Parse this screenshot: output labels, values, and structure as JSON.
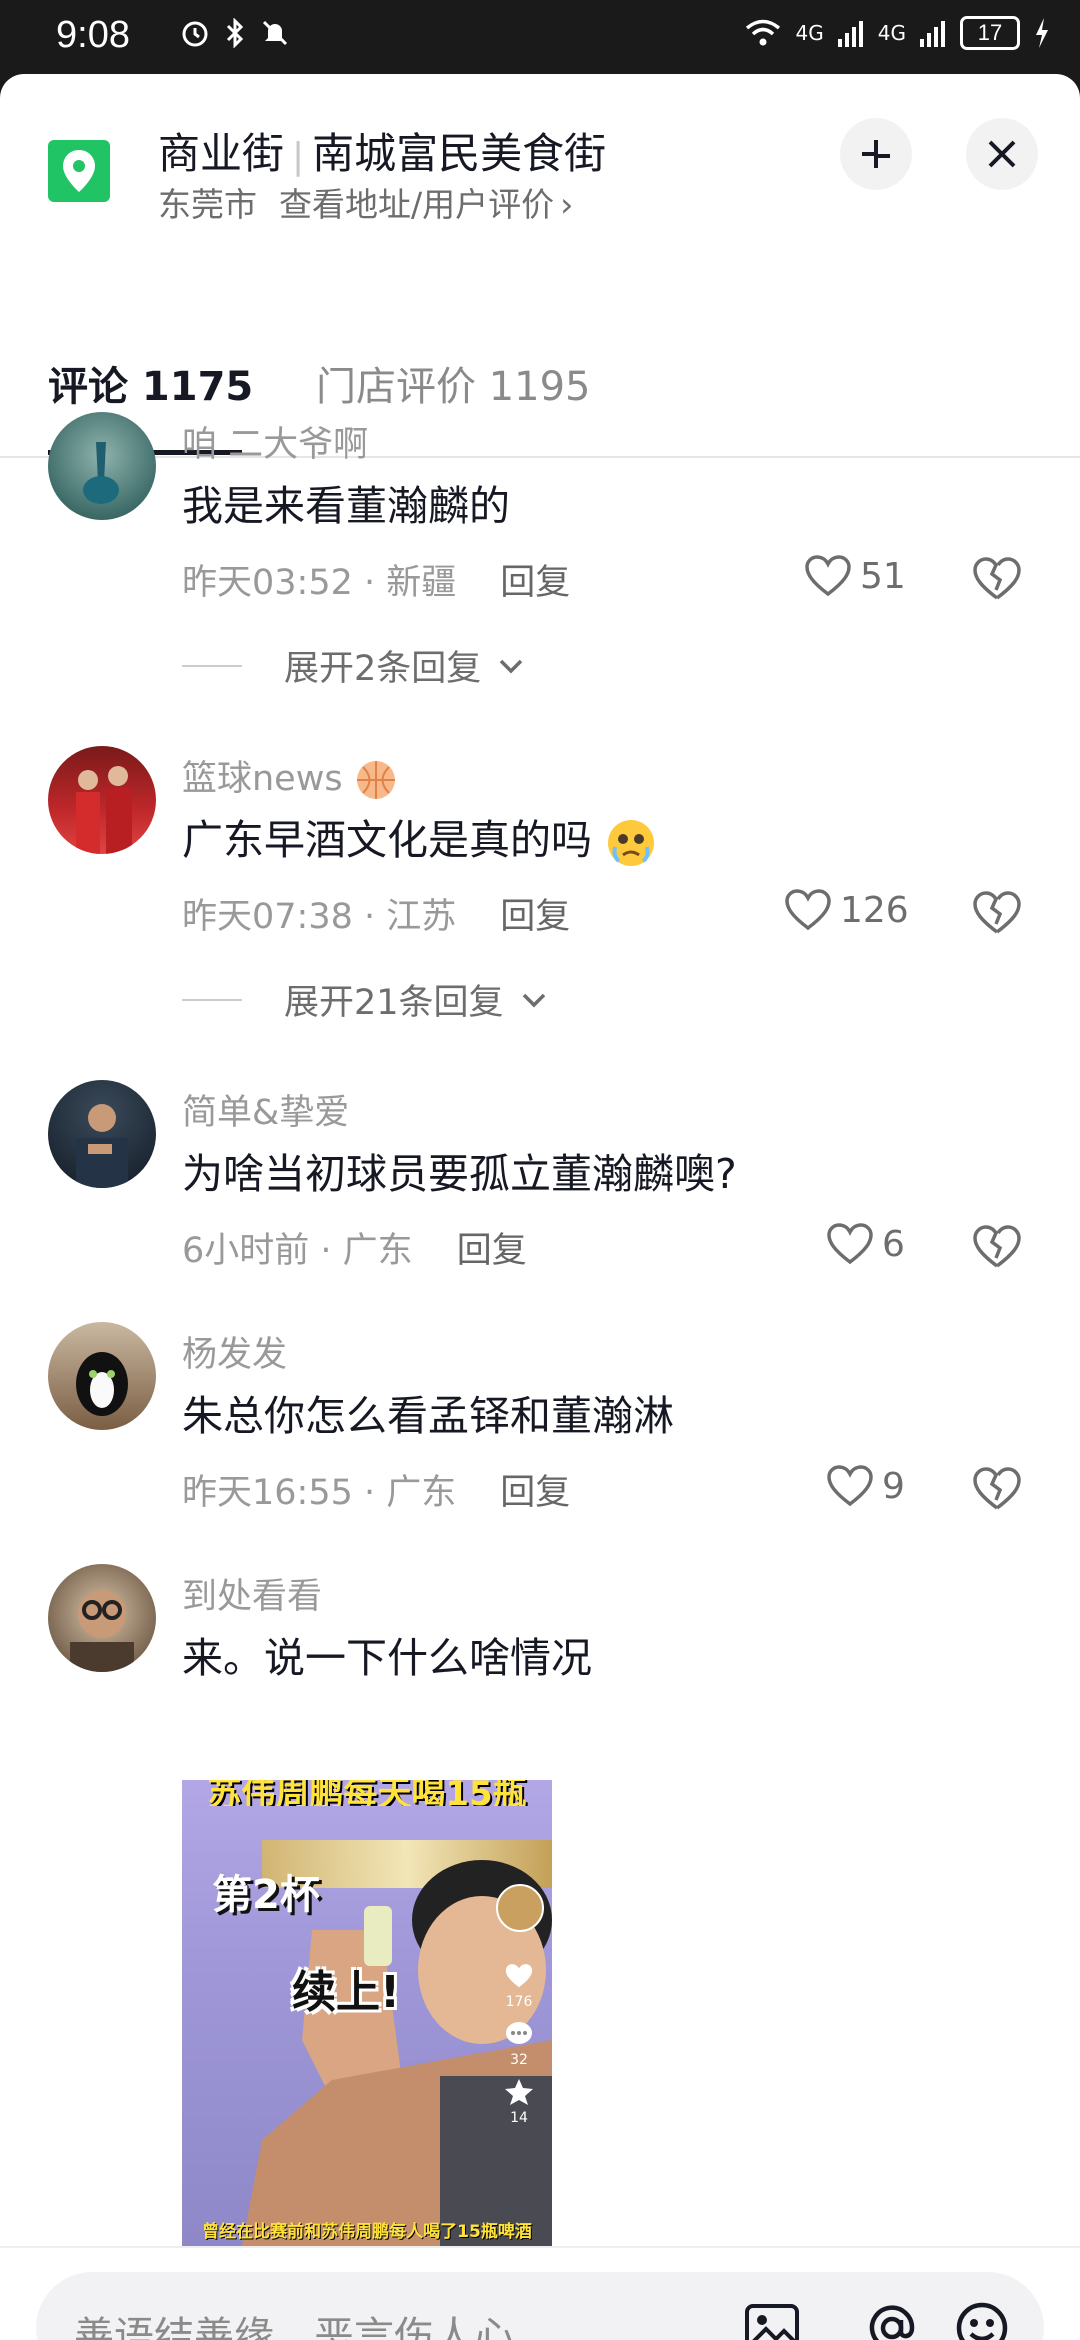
{
  "status_bar": {
    "time": "9:08",
    "left_icons": [
      "alarm-icon",
      "bluetooth-icon",
      "mute-icon"
    ],
    "signal_label_1": "4G",
    "signal_label_2": "4G",
    "battery": "17"
  },
  "header": {
    "title_left": "商业街",
    "title_right": "南城富民美食街",
    "city": "东莞市",
    "sub_link": "查看地址/用户评价",
    "chevron": "›"
  },
  "tabs": [
    {
      "label": "评论 1175",
      "active": true
    },
    {
      "label": "门店评价 1195",
      "active": false
    }
  ],
  "comments": [
    {
      "username": "咱  二大爷啊",
      "text": "我是来看董瀚麟的",
      "time": "昨天03:52",
      "location": "新疆",
      "reply_label": "回复",
      "likes": "51",
      "expand": "展开2条回复"
    },
    {
      "username": "篮球news",
      "text": "广东早酒文化是真的吗",
      "time": "昨天07:38",
      "location": "江苏",
      "reply_label": "回复",
      "likes": "126",
      "expand": "展开21条回复"
    },
    {
      "username": "简单&挚爱",
      "text": "为啥当初球员要孤立董瀚麟噢?",
      "time": "6小时前",
      "location": "广东",
      "reply_label": "回复",
      "likes": "6"
    },
    {
      "username": "杨发发",
      "text": "朱总你怎么看孟铎和董瀚淋",
      "time": "昨天16:55",
      "location": "广东",
      "reply_label": "回复",
      "likes": "9"
    },
    {
      "username": "到处看看",
      "text": "来。说一下什么啥情况"
    }
  ],
  "video": {
    "top_caption": "苏伟周鹏每天喝15瓶",
    "cup_label": "第2杯",
    "center_text": "续上!",
    "side_counts": [
      "176",
      "32",
      "14"
    ],
    "bottom_caption": "曾经在比赛前和苏伟周鹏每人喝了15瓶啤酒"
  },
  "input_bar": {
    "placeholder": "善语结善缘，恶言伤人心"
  },
  "colors": {
    "pin_green": "#20c464",
    "text_primary": "#161823",
    "text_secondary": "#999999"
  }
}
